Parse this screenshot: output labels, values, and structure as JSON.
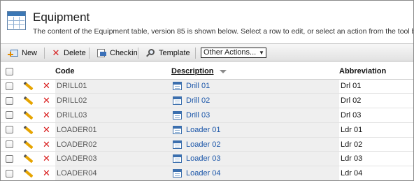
{
  "header": {
    "title": "Equipment",
    "subtitle": "The content of the Equipment table, version 85 is shown below. Select a row to edit, or select an action from the tool bar."
  },
  "toolbar": {
    "new_label": "New",
    "delete_label": "Delete",
    "checkin_label": "Checkin",
    "template_label": "Template",
    "other_actions": {
      "selected": "Other Actions..."
    }
  },
  "table": {
    "columns": {
      "code": "Code",
      "description": "Description",
      "abbreviation": "Abbreviation"
    },
    "sort": {
      "column": "Description",
      "direction": "descending"
    },
    "rows": [
      {
        "code": "DRILL01",
        "description": "Drill 01",
        "abbreviation": "Drl 01"
      },
      {
        "code": "DRILL02",
        "description": "Drill 02",
        "abbreviation": "Drl 02"
      },
      {
        "code": "DRILL03",
        "description": "Drill 03",
        "abbreviation": "Drl 03"
      },
      {
        "code": "LOADER01",
        "description": "Loader 01",
        "abbreviation": "Ldr 01"
      },
      {
        "code": "LOADER02",
        "description": "Loader 02",
        "abbreviation": "Ldr 02"
      },
      {
        "code": "LOADER03",
        "description": "Loader 03",
        "abbreviation": "Ldr 03"
      },
      {
        "code": "LOADER04",
        "description": "Loader 04",
        "abbreviation": "Ldr 04"
      }
    ]
  },
  "colors": {
    "link": "#1a55a8",
    "delete": "#d81818",
    "header_icon": "#3c78b5"
  }
}
